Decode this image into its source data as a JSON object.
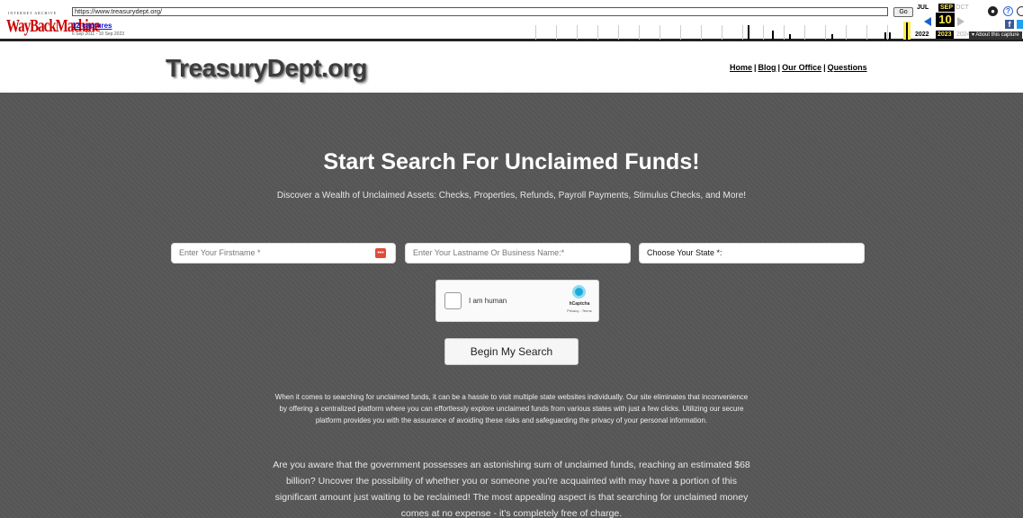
{
  "wayback": {
    "logo_top": "INTERNET ARCHIVE",
    "logo_main": "WayBackMachine",
    "url": "https://www.treasurydept.org/",
    "go_label": "Go",
    "captures": "12 captures",
    "range": "6 Sep 2011 - 10 Sep 2023",
    "months": {
      "prev": "JUL",
      "current": "SEP",
      "next": "OCT"
    },
    "day": "10",
    "years": {
      "prev": "2022",
      "current": "2023",
      "next": "2024"
    },
    "about": "▾ About this capture",
    "fb": "f",
    "help": "?"
  },
  "site": {
    "logo": "TreasuryDept.org",
    "nav": {
      "home": "Home",
      "blog": "Blog",
      "office": "Our Office",
      "questions": "Questions",
      "sep": "|"
    }
  },
  "hero": {
    "title": "Start Search For Unclaimed Funds!",
    "subtitle": "Discover a Wealth of Unclaimed Assets: Checks, Properties, Refunds, Payroll Payments, Stimulus Checks, and More!",
    "firstname_placeholder": "Enter Your Firstname *",
    "lastname_placeholder": "Enter Your Lastname Or Business Name:*",
    "state_label": "Choose Your State *:",
    "captcha_label": "I am human",
    "captcha_brand": "hCaptcha",
    "captcha_terms": "Privacy - Terms",
    "button": "Begin My Search",
    "para1": "When it comes to searching for unclaimed funds, it can be a hassle to visit multiple state websites individually. Our site eliminates that inconvenience by offering a centralized platform where you can effortlessly explore unclaimed funds from various states with just a few clicks. Utilizing our secure platform provides you with the assurance of avoiding these risks and safeguarding the privacy of your personal information.",
    "para2": "Are you aware that the government possesses an astonishing sum of unclaimed funds, reaching an estimated $68 billion? Uncover the possibility of whether you or someone you're acquainted with may have a portion of this significant amount just waiting to be reclaimed! The most appealing aspect is that searching for unclaimed money comes at no expense - it's completely free of charge."
  },
  "colors": {
    "hero_bg": "#575757",
    "wayback_red": "#c00",
    "highlight": "#ffec50"
  }
}
